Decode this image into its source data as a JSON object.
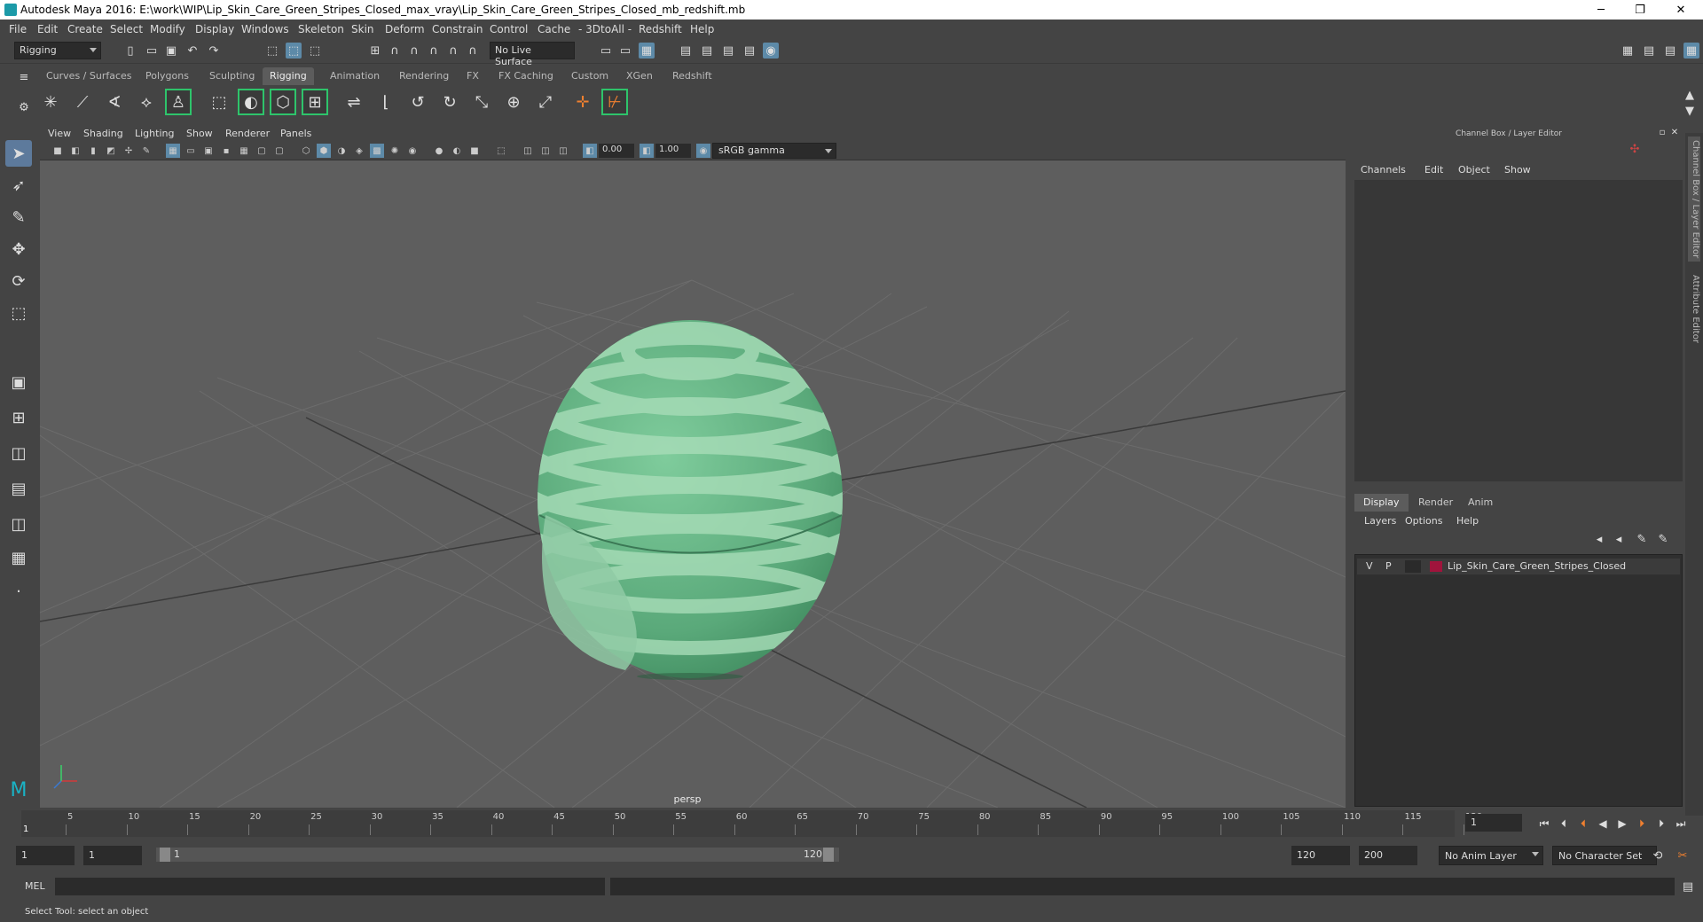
{
  "window": {
    "title": "Autodesk Maya 2016: E:\\work\\WIP\\Lip_Skin_Care_Green_Stripes_Closed_max_vray\\Lip_Skin_Care_Green_Stripes_Closed_mb_redshift.mb",
    "minimize": "─",
    "restore": "❐",
    "close": "✕"
  },
  "menubar": {
    "items": [
      "File",
      "Edit",
      "Create",
      "Select",
      "Modify",
      "Display",
      "Windows",
      "Skeleton",
      "Skin",
      "Deform",
      "Constrain",
      "Control",
      "Cache",
      "- 3DtoAll -",
      "Redshift",
      "Help"
    ]
  },
  "statusline": {
    "menu_set": "Rigging",
    "live_surface": "No Live Surface"
  },
  "shelf": {
    "tabs": [
      "Curves / Surfaces",
      "Polygons",
      "Sculpting",
      "Rigging",
      "Animation",
      "Rendering",
      "FX",
      "FX Caching",
      "Custom",
      "XGen",
      "Redshift"
    ],
    "active_tab": "Rigging"
  },
  "viewport": {
    "menu": [
      "View",
      "Shading",
      "Lighting",
      "Show",
      "Renderer",
      "Panels"
    ],
    "exposure": "0.00",
    "gamma": "1.00",
    "color_space": "sRGB gamma",
    "camera_label": "persp"
  },
  "channel_box": {
    "title": "Channel Box / Layer Editor",
    "menu": [
      "Channels",
      "Edit",
      "Object",
      "Show"
    ]
  },
  "layer_editor": {
    "tabs": [
      "Display",
      "Render",
      "Anim"
    ],
    "active_tab": "Display",
    "menu": [
      "Layers",
      "Options",
      "Help"
    ],
    "layers": [
      {
        "visible": "V",
        "playback": "P",
        "name": "Lip_Skin_Care_Green_Stripes_Closed",
        "color": "#a0143c"
      }
    ]
  },
  "side_tabs": [
    "Channel Box / Layer Editor",
    "Attribute Editor"
  ],
  "timeline": {
    "ticks": [
      "5",
      "10",
      "15",
      "20",
      "25",
      "30",
      "35",
      "40",
      "45",
      "50",
      "55",
      "60",
      "65",
      "70",
      "75",
      "80",
      "85",
      "90",
      "95",
      "100",
      "105",
      "110",
      "115",
      "120"
    ],
    "current_frame_marker": "1",
    "current_frame": "1"
  },
  "range": {
    "start": "1",
    "playback_start": "1",
    "range_start_label": "1",
    "range_end_label": "120",
    "playback_end": "120",
    "end": "200",
    "anim_layer": "No Anim Layer",
    "character_set": "No Character Set"
  },
  "command_line": {
    "language": "MEL"
  },
  "help_line": {
    "text": "Select Tool: select an object"
  },
  "colors": {
    "object_green": "#6ab88a",
    "stripe_green": "#9fd8b0",
    "viewport_bg": "#5e5e5e",
    "active_blue": "#5d8aa8"
  }
}
